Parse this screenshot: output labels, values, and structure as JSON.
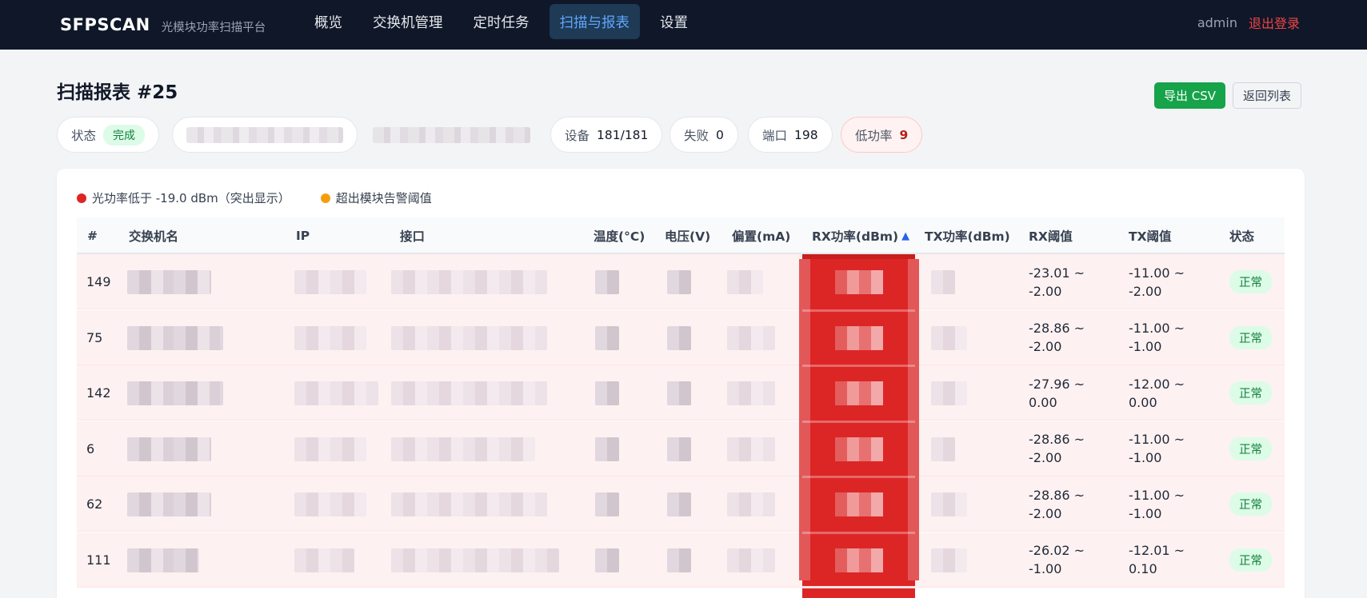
{
  "nav": {
    "brand": "SFPSCAN",
    "subtitle": "光模块功率扫描平台",
    "items": [
      "概览",
      "交换机管理",
      "定时任务",
      "扫描与报表",
      "设置"
    ],
    "active_index": 3,
    "user": "admin",
    "logout": "退出登录"
  },
  "page": {
    "title": "扫描报表 #25",
    "export_label": "导出 CSV",
    "back_label": "返回列表"
  },
  "summary": {
    "status_label": "状态",
    "status_value": "完成",
    "devices_label": "设备",
    "devices_value": "181/181",
    "failed_label": "失败",
    "failed_value": "0",
    "ports_label": "端口",
    "ports_value": "198",
    "lowpower_label": "低功率",
    "lowpower_value": "9"
  },
  "legend": {
    "red_label": "光功率低于 -19.0 dBm（突出显示）",
    "orange_label": "超出模块告警阈值",
    "red_color": "#dc2626",
    "orange_color": "#f59e0b"
  },
  "table": {
    "headers": {
      "index": "#",
      "switch": "交换机名",
      "ip": "IP",
      "interface": "接口",
      "temp": "温度(°C)",
      "voltage": "电压(V)",
      "bias": "偏置(mA)",
      "rx": "RX功率(dBm)",
      "rx_sort": "▲",
      "tx": "TX功率(dBm)",
      "rx_thresh": "RX阈值",
      "tx_thresh": "TX阈值",
      "status": "状态"
    },
    "rows": [
      {
        "index": "149",
        "rx_thresh_1": "-23.01 ~",
        "rx_thresh_2": "-2.00",
        "tx_thresh_1": "-11.00 ~",
        "tx_thresh_2": "-2.00",
        "status": "正常"
      },
      {
        "index": "75",
        "rx_thresh_1": "-28.86 ~",
        "rx_thresh_2": "-2.00",
        "tx_thresh_1": "-11.00 ~",
        "tx_thresh_2": "-1.00",
        "status": "正常"
      },
      {
        "index": "142",
        "rx_thresh_1": "-27.96 ~",
        "rx_thresh_2": "0.00",
        "tx_thresh_1": "-12.00 ~",
        "tx_thresh_2": "0.00",
        "status": "正常"
      },
      {
        "index": "6",
        "rx_thresh_1": "-28.86 ~",
        "rx_thresh_2": "-2.00",
        "tx_thresh_1": "-11.00 ~",
        "tx_thresh_2": "-1.00",
        "status": "正常"
      },
      {
        "index": "62",
        "rx_thresh_1": "-28.86 ~",
        "rx_thresh_2": "-2.00",
        "tx_thresh_1": "-11.00 ~",
        "tx_thresh_2": "-1.00",
        "status": "正常"
      },
      {
        "index": "111",
        "rx_thresh_1": "-26.02 ~",
        "rx_thresh_2": "-1.00",
        "tx_thresh_1": "-12.01 ~",
        "tx_thresh_2": "0.10",
        "status": "正常"
      }
    ]
  }
}
